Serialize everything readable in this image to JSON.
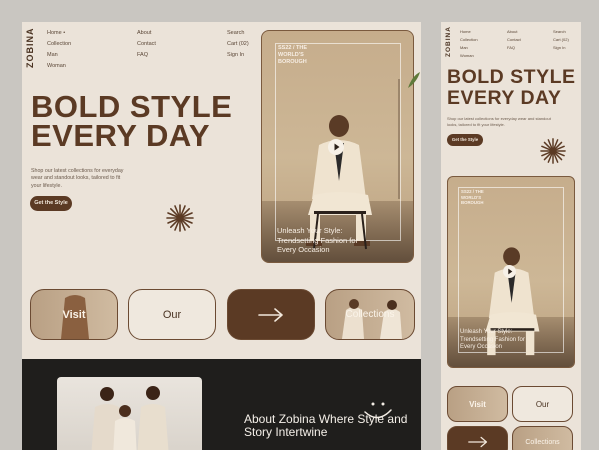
{
  "brand": "ZOBINA",
  "nav": {
    "col1": [
      "Home •",
      "Collection",
      "Man",
      "Woman"
    ],
    "col2": [
      "About",
      "Contact",
      "FAQ"
    ],
    "col3": [
      "Search",
      "Cart (02)",
      "Sign In"
    ]
  },
  "hero": {
    "line1": "BOLD STYLE",
    "line2": "EVERY DAY",
    "subtitle": "Shop our latest collections for everyday wear and standout looks, tailored to fit your lifestyle.",
    "cta": "Get the Style"
  },
  "photo": {
    "tag": "SS22 / THE WORLD'S BOROUGH",
    "caption": "Unleash Your Style: Trendsetting Fashion for Every Occasion"
  },
  "pills": {
    "visit": "Visit",
    "our": "Our",
    "collections": "Collections"
  },
  "about": {
    "title": "About Zobina Where Style and Story Intertwine"
  },
  "mobile": {
    "brand": "ZOBINA",
    "nav_col1": [
      "Home",
      "Collection",
      "Man",
      "Woman"
    ],
    "nav_col2": [
      "About",
      "Contact",
      "FAQ"
    ],
    "nav_col3": [
      "Search",
      "Cart (02)",
      "Sign In"
    ],
    "hero_line1": "BOLD STYLE",
    "hero_line2": "EVERY DAY",
    "subtitle": "Shop our latest collections for everyday wear and standout looks, tailored to fit your lifestyle.",
    "cta": "Get the Style",
    "tag": "SS22 / THE WORLD'S BOROUGH",
    "caption": "Unleash Your Style: Trendsetting Fashion for Every Occasion",
    "pill_visit": "Visit",
    "pill_our": "Our",
    "pill_collections": "Collections"
  },
  "colors": {
    "brown": "#5b3a24",
    "cream": "#ebe3d9",
    "dark": "#1f1e1c"
  }
}
